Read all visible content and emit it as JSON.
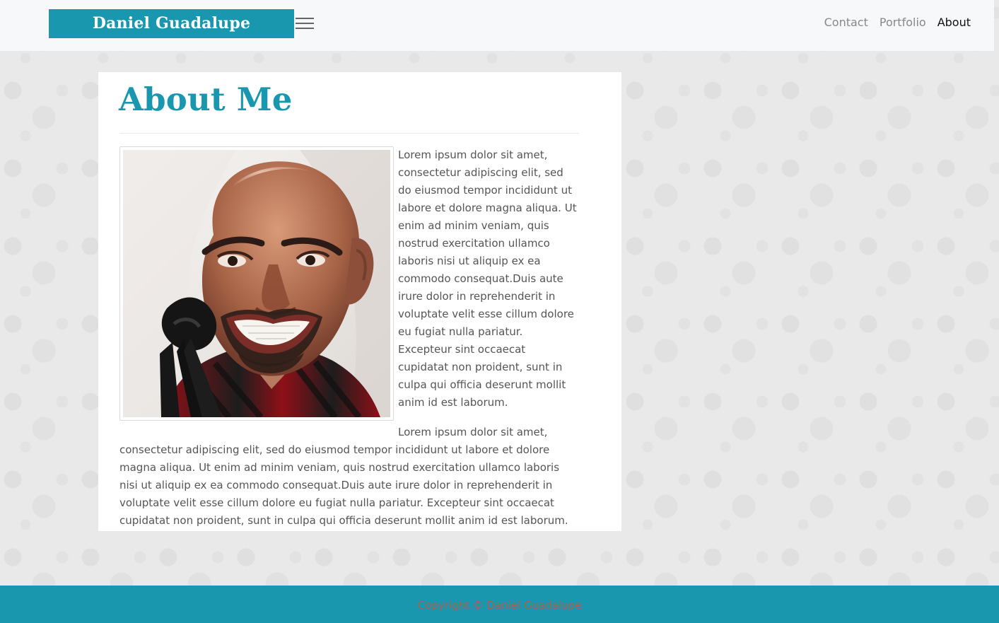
{
  "navbar": {
    "brand": "Daniel Guadalupe",
    "links": [
      {
        "label": "Contact"
      },
      {
        "label": "Portfolio"
      },
      {
        "label": "About"
      }
    ],
    "menu_icon": "hamburger-menu-icon"
  },
  "main": {
    "title": "About Me",
    "paragraphs": [
      "Lorem ipsum dolor sit amet, consectetur adipiscing elit, sed do eiusmod tempor incididunt ut labore et dolore magna aliqua. Ut enim ad minim veniam, quis nostrud exercitation ullamco laboris nisi ut aliquip ex ea commodo consequat.Duis aute irure dolor in reprehenderit in voluptate velit esse cillum dolore eu fugiat nulla pariatur. Excepteur sint occaecat cupidatat non proident, sunt in culpa qui officia deserunt mollit anim id est laborum.",
      "Lorem ipsum dolor sit amet, consectetur adipiscing elit, sed do eiusmod tempor incididunt ut labore et dolore magna aliqua. Ut enim ad minim veniam, quis nostrud exercitation ullamco laboris nisi ut aliquip ex ea commodo consequat.Duis aute irure dolor in reprehenderit in voluptate velit esse cillum dolore eu fugiat nulla pariatur. Excepteur sint occaecat cupidatat non proident, sunt in culpa qui officia deserunt mollit anim id est laborum."
    ]
  },
  "footer": {
    "text": "Copyright © Daniel Guadalupe"
  },
  "colors": {
    "accent": "#1997ae",
    "navbar_background": "#f7f8f9",
    "page_background": "#e9e9e9",
    "footer_text": "#b35b4b"
  }
}
